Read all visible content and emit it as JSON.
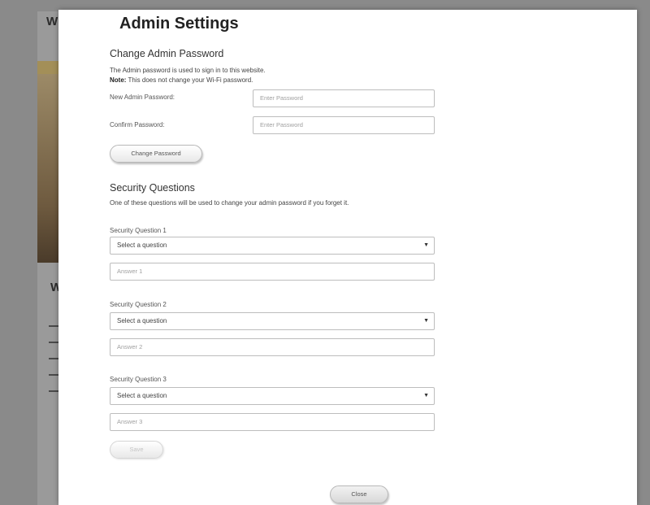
{
  "modal": {
    "title": "Admin Settings",
    "change_password": {
      "heading": "Change Admin Password",
      "description": "The Admin password is used to sign in to this website.",
      "note_label": "Note:",
      "note_text": " This does not change your Wi-Fi password.",
      "new_label": "New Admin Password:",
      "new_placeholder": "Enter Password",
      "confirm_label": "Confirm Password:",
      "confirm_placeholder": "Enter Password",
      "button": "Change Password"
    },
    "security": {
      "heading": "Security Questions",
      "description": "One of these questions will be used to change your admin password if you forget it.",
      "questions": [
        {
          "label": "Security Question 1",
          "selected": "Select a question",
          "answer_placeholder": "Answer 1"
        },
        {
          "label": "Security Question 2",
          "selected": "Select a question",
          "answer_placeholder": "Answer 2"
        },
        {
          "label": "Security Question 3",
          "selected": "Select a question",
          "answer_placeholder": "Answer 3"
        }
      ],
      "save_button": "Save"
    },
    "close_button": "Close"
  },
  "background": {
    "letter": "W",
    "letter2": "W"
  }
}
